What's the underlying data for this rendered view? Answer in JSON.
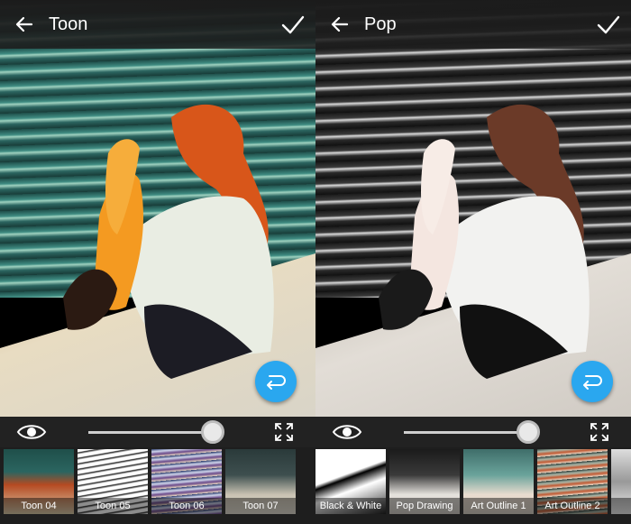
{
  "colors": {
    "accent": "#2aa7ef",
    "toolbar": "#1b1b1b"
  },
  "screens": [
    {
      "title": "Toon",
      "slider_value": 0.92,
      "filters": [
        {
          "label": "Toon 04",
          "selected": true
        },
        {
          "label": "Toon 05",
          "selected": false
        },
        {
          "label": "Toon 06",
          "selected": false
        },
        {
          "label": "Toon 07",
          "selected": false
        }
      ]
    },
    {
      "title": "Pop",
      "slider_value": 0.92,
      "filters": [
        {
          "label": "Black & White",
          "selected": false
        },
        {
          "label": "Pop Drawing",
          "selected": true
        },
        {
          "label": "Art Outline 1",
          "selected": false
        },
        {
          "label": "Art Outline 2",
          "selected": false
        },
        {
          "label": "",
          "selected": false
        }
      ]
    }
  ],
  "icons": {
    "back": "arrow-left-icon",
    "confirm": "check-icon",
    "undo": "undo-icon",
    "compare": "eye-icon",
    "fullscreen": "expand-icon"
  }
}
